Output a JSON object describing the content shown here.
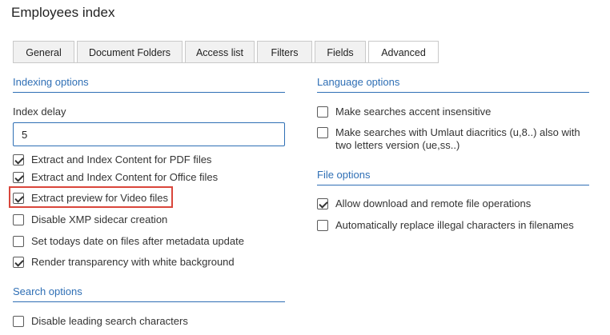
{
  "page": {
    "title": "Employees index"
  },
  "tabs": [
    {
      "label": "General"
    },
    {
      "label": "Document Folders"
    },
    {
      "label": "Access list"
    },
    {
      "label": "Filters"
    },
    {
      "label": "Fields"
    },
    {
      "label": "Advanced"
    }
  ],
  "active_tab": "Advanced",
  "indexing": {
    "heading": "Indexing options",
    "index_delay_label": "Index delay",
    "index_delay_value": "5",
    "options": [
      {
        "label": "Extract and Index Content for PDF files",
        "checked": true
      },
      {
        "label": "Extract and Index Content for Office files",
        "checked": true
      },
      {
        "label": "Extract preview for Video files",
        "checked": true
      },
      {
        "label": "Disable XMP sidecar creation",
        "checked": false
      },
      {
        "label": "Set todays date on files after metadata update",
        "checked": false
      },
      {
        "label": "Render transparency with white background",
        "checked": true
      }
    ]
  },
  "search": {
    "heading": "Search options",
    "options": [
      {
        "label": "Disable leading search characters",
        "checked": false
      }
    ]
  },
  "language": {
    "heading": "Language options",
    "options": [
      {
        "label": "Make searches accent insensitive",
        "checked": false
      },
      {
        "label": "Make searches with Umlaut diacritics (u,8..) also with two letters version (ue,ss..)",
        "checked": false
      }
    ]
  },
  "file": {
    "heading": "File options",
    "options": [
      {
        "label": "Allow download and remote file operations",
        "checked": true
      },
      {
        "label": "Automatically replace illegal characters in filenames",
        "checked": false
      }
    ]
  },
  "colors": {
    "accent": "#2f6fb5",
    "highlight": "#d9463b"
  }
}
